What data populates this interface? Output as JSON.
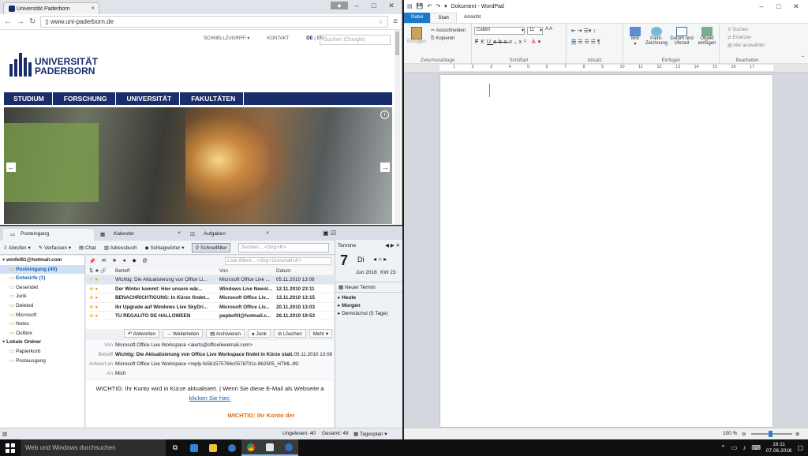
{
  "chrome": {
    "tab_title": "Universität Paderborn",
    "url": "www.uni-paderborn.de",
    "site": {
      "links": [
        "SCHNELLZUGRIFF",
        "KONTAKT"
      ],
      "lang_de": "DE",
      "lang_en": "EN",
      "search_placeholder": "Suchen (Google)",
      "logo_line1": "UNIVERSITÄT",
      "logo_line2": "PADERBORN",
      "nav": [
        "STUDIUM",
        "FORSCHUNG",
        "UNIVERSITÄT",
        "FAKULTÄTEN"
      ]
    }
  },
  "wordpad": {
    "title": "Dokument - WordPad",
    "tabs": [
      "Datei",
      "Start",
      "Ansicht"
    ],
    "clipboard": {
      "paste": "Einfügen",
      "cut": "Ausschneiden",
      "copy": "Kopieren",
      "label": "Zwischenablage"
    },
    "font": {
      "name": "Calibri",
      "size": "11",
      "label": "Schriftart"
    },
    "paragraph_label": "Absatz",
    "insert": {
      "picture": "Bild",
      "paint": "Paint-Zeichnung",
      "datetime": "Datum und Uhrzeit",
      "object": "Objekt einfügen",
      "label": "Einfügen"
    },
    "edit": {
      "find": "Suchen",
      "replace": "Ersetzen",
      "select_all": "Alle auswählen",
      "label": "Bearbeiten"
    },
    "ruler": [
      "1",
      "2",
      "3",
      "4",
      "5",
      "6",
      "7",
      "8",
      "9",
      "10",
      "11",
      "12",
      "13",
      "14",
      "15",
      "16",
      "17"
    ],
    "zoom": "100 %"
  },
  "thunderbird": {
    "tabs": [
      "Posteingang",
      "Kalender",
      "Aufgaben"
    ],
    "toolbar": {
      "get": "Abrufen",
      "write": "Verfassen",
      "chat": "Chat",
      "address": "Adressbuch",
      "tags": "Schlagwörter",
      "quickfilter": "Schnellfilter",
      "search_ph": "Suchen... <Strg+K>"
    },
    "filter_ph": "Liste filtern... <Strg+Umschalt+K>",
    "folders": [
      {
        "name": "winfel81@hotmail.com",
        "bold": true,
        "indent": 0
      },
      {
        "name": "Posteingang (40)",
        "bold": true,
        "indent": 1,
        "selected": true,
        "blue": true
      },
      {
        "name": "Entwürfe (1)",
        "bold": true,
        "indent": 1,
        "blue": true
      },
      {
        "name": "Gesendet",
        "indent": 1
      },
      {
        "name": "Junk",
        "indent": 1
      },
      {
        "name": "Deleted",
        "indent": 1
      },
      {
        "name": "Microsoft",
        "indent": 1
      },
      {
        "name": "Notes",
        "indent": 1
      },
      {
        "name": "Outbox",
        "indent": 1
      },
      {
        "name": "Lokale Ordner",
        "bold": true,
        "indent": 0
      },
      {
        "name": "Papierkorb",
        "indent": 1
      },
      {
        "name": "Postausgang",
        "indent": 1
      }
    ],
    "columns": {
      "subject": "Betreff",
      "from": "Von",
      "date": "Datum"
    },
    "messages": [
      {
        "subject": "Wichtig: Die Aktualisierung von Office Li...",
        "from": "Microsoft Office Live ...",
        "date": "05.11.2010 13:08",
        "bold": false,
        "sel": true
      },
      {
        "subject": "Der Winter kommt: Hier unsere wär...",
        "from": "Windows Live Newsl...",
        "date": "12.11.2010 23:11",
        "bold": true
      },
      {
        "subject": "BENACHRICHTIGUNG: In Kürze findet...",
        "from": "Microsoft Office Liv...",
        "date": "13.11.2010 13:15",
        "bold": true
      },
      {
        "subject": "Ihr Upgrade auf Windows Live SkyDri...",
        "from": "Microsoft Office Liv...",
        "date": "20.11.2010 13:03",
        "bold": true
      },
      {
        "subject": "TU REGALITO DE HALLOWEEN",
        "from": "pepbofill@hotmail.c...",
        "date": "26.11.2010 19:53",
        "bold": true
      }
    ],
    "actions": [
      "Antworten",
      "Weiterleiten",
      "Archivieren",
      "Junk",
      "Löschen",
      "Mehr"
    ],
    "header": {
      "from_label": "Von",
      "from": "Microsoft Office Live Workspace <alerts@officeliveemail.com>",
      "subject_label": "Betreff",
      "subject": "Wichtig: Die Aktualisierung von Office Live Workspace findet in Kürze statt.",
      "date": "05.11.2010 13:08",
      "reply_label": "Antwort an",
      "reply": "Microsoft Office Live Workspace <reply-fe5b1575766c0578701c-862505_HTML-89:",
      "to_label": "An",
      "to": "Mich"
    },
    "body": {
      "text": "WICHTIG: Ihr Konto wird in Kürze aktualisiert. | Wenn Sie diese E-Mail als Webseite a",
      "link": "klicken Sie hier.",
      "heading": "WICHTIG: Ihr Konto der"
    },
    "today": {
      "title": "Termine",
      "day_num": "7",
      "day_name": "Di",
      "month": "Jun 2016",
      "week": "KW 23",
      "new": "Neuer Termin",
      "sections": [
        "Heute",
        "Morgen",
        "Demnächst (5 Tage)"
      ]
    },
    "status": {
      "unread": "Ungelesen: 40",
      "total": "Gesamt: 49",
      "plan": "Tagesplan"
    }
  },
  "taskbar": {
    "search": "Web und Windows durchsuchen",
    "time": "16:11",
    "date": "07.06.2016"
  }
}
